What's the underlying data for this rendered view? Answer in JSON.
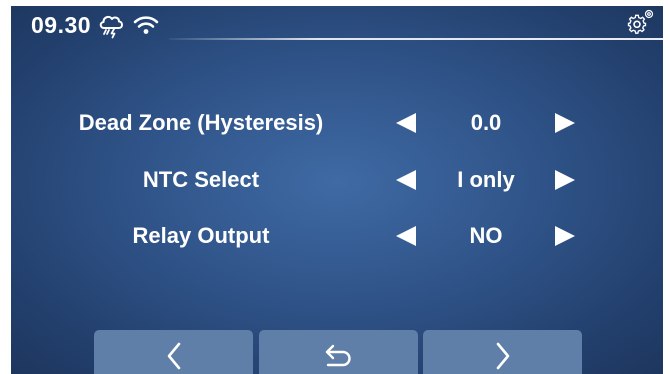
{
  "status_bar": {
    "time": "09.30",
    "weather_icon": "storm-cloud-icon",
    "wifi_icon": "wifi-icon",
    "settings_icon": "gear-icon"
  },
  "settings": [
    {
      "label": "Dead Zone (Hysteresis)",
      "value": "0.0"
    },
    {
      "label": "NTC Select",
      "value": "I only"
    },
    {
      "label": "Relay Output",
      "value": "NO"
    }
  ],
  "nav": {
    "prev_icon": "chevron-left-icon",
    "back_icon": "return-arrow-icon",
    "next_icon": "chevron-right-icon"
  },
  "colors": {
    "background": "#2f5388",
    "nav_button": "#5f7fa8",
    "text": "#ffffff"
  }
}
